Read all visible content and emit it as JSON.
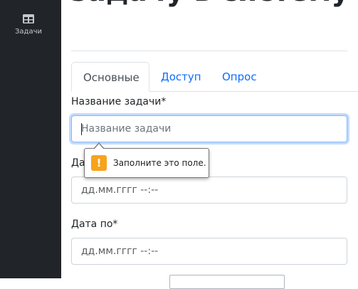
{
  "sidebar": {
    "items": [
      {
        "label": "Задачи",
        "icon": "table-icon"
      }
    ]
  },
  "page": {
    "title": "задачу в систему"
  },
  "tabs": [
    {
      "label": "Основные",
      "active": true
    },
    {
      "label": "Доступ",
      "active": false
    },
    {
      "label": "Опрос",
      "active": false
    }
  ],
  "form": {
    "task_name": {
      "label": "Название задачи*",
      "placeholder": "Название задачи",
      "value": ""
    },
    "date_from": {
      "label": "Дата с*",
      "value": "дд.мм.гггг --:--"
    },
    "date_to": {
      "label": "Дата по*",
      "value": "дд.мм.гггг --:--"
    }
  },
  "validation": {
    "message": "Заполните это поле.",
    "icon": "warning-icon",
    "icon_glyph": "!",
    "icon_color": "#f7a31c"
  },
  "colors": {
    "sidebar_bg": "#212529",
    "tab_link": "#0d6efd",
    "focus_border": "#86b7fe"
  }
}
